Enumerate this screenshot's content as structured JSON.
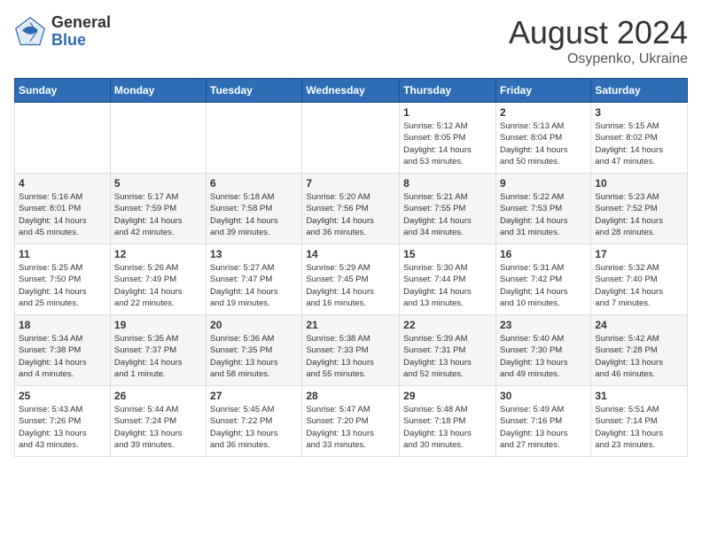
{
  "header": {
    "logo_general": "General",
    "logo_blue": "Blue",
    "month_year": "August 2024",
    "location": "Osypenko, Ukraine"
  },
  "days_of_week": [
    "Sunday",
    "Monday",
    "Tuesday",
    "Wednesday",
    "Thursday",
    "Friday",
    "Saturday"
  ],
  "weeks": [
    [
      {
        "day": "",
        "info": ""
      },
      {
        "day": "",
        "info": ""
      },
      {
        "day": "",
        "info": ""
      },
      {
        "day": "",
        "info": ""
      },
      {
        "day": "1",
        "info": "Sunrise: 5:12 AM\nSunset: 8:05 PM\nDaylight: 14 hours\nand 53 minutes."
      },
      {
        "day": "2",
        "info": "Sunrise: 5:13 AM\nSunset: 8:04 PM\nDaylight: 14 hours\nand 50 minutes."
      },
      {
        "day": "3",
        "info": "Sunrise: 5:15 AM\nSunset: 8:02 PM\nDaylight: 14 hours\nand 47 minutes."
      }
    ],
    [
      {
        "day": "4",
        "info": "Sunrise: 5:16 AM\nSunset: 8:01 PM\nDaylight: 14 hours\nand 45 minutes."
      },
      {
        "day": "5",
        "info": "Sunrise: 5:17 AM\nSunset: 7:59 PM\nDaylight: 14 hours\nand 42 minutes."
      },
      {
        "day": "6",
        "info": "Sunrise: 5:18 AM\nSunset: 7:58 PM\nDaylight: 14 hours\nand 39 minutes."
      },
      {
        "day": "7",
        "info": "Sunrise: 5:20 AM\nSunset: 7:56 PM\nDaylight: 14 hours\nand 36 minutes."
      },
      {
        "day": "8",
        "info": "Sunrise: 5:21 AM\nSunset: 7:55 PM\nDaylight: 14 hours\nand 34 minutes."
      },
      {
        "day": "9",
        "info": "Sunrise: 5:22 AM\nSunset: 7:53 PM\nDaylight: 14 hours\nand 31 minutes."
      },
      {
        "day": "10",
        "info": "Sunrise: 5:23 AM\nSunset: 7:52 PM\nDaylight: 14 hours\nand 28 minutes."
      }
    ],
    [
      {
        "day": "11",
        "info": "Sunrise: 5:25 AM\nSunset: 7:50 PM\nDaylight: 14 hours\nand 25 minutes."
      },
      {
        "day": "12",
        "info": "Sunrise: 5:26 AM\nSunset: 7:49 PM\nDaylight: 14 hours\nand 22 minutes."
      },
      {
        "day": "13",
        "info": "Sunrise: 5:27 AM\nSunset: 7:47 PM\nDaylight: 14 hours\nand 19 minutes."
      },
      {
        "day": "14",
        "info": "Sunrise: 5:29 AM\nSunset: 7:45 PM\nDaylight: 14 hours\nand 16 minutes."
      },
      {
        "day": "15",
        "info": "Sunrise: 5:30 AM\nSunset: 7:44 PM\nDaylight: 14 hours\nand 13 minutes."
      },
      {
        "day": "16",
        "info": "Sunrise: 5:31 AM\nSunset: 7:42 PM\nDaylight: 14 hours\nand 10 minutes."
      },
      {
        "day": "17",
        "info": "Sunrise: 5:32 AM\nSunset: 7:40 PM\nDaylight: 14 hours\nand 7 minutes."
      }
    ],
    [
      {
        "day": "18",
        "info": "Sunrise: 5:34 AM\nSunset: 7:38 PM\nDaylight: 14 hours\nand 4 minutes."
      },
      {
        "day": "19",
        "info": "Sunrise: 5:35 AM\nSunset: 7:37 PM\nDaylight: 14 hours\nand 1 minute."
      },
      {
        "day": "20",
        "info": "Sunrise: 5:36 AM\nSunset: 7:35 PM\nDaylight: 13 hours\nand 58 minutes."
      },
      {
        "day": "21",
        "info": "Sunrise: 5:38 AM\nSunset: 7:33 PM\nDaylight: 13 hours\nand 55 minutes."
      },
      {
        "day": "22",
        "info": "Sunrise: 5:39 AM\nSunset: 7:31 PM\nDaylight: 13 hours\nand 52 minutes."
      },
      {
        "day": "23",
        "info": "Sunrise: 5:40 AM\nSunset: 7:30 PM\nDaylight: 13 hours\nand 49 minutes."
      },
      {
        "day": "24",
        "info": "Sunrise: 5:42 AM\nSunset: 7:28 PM\nDaylight: 13 hours\nand 46 minutes."
      }
    ],
    [
      {
        "day": "25",
        "info": "Sunrise: 5:43 AM\nSunset: 7:26 PM\nDaylight: 13 hours\nand 43 minutes."
      },
      {
        "day": "26",
        "info": "Sunrise: 5:44 AM\nSunset: 7:24 PM\nDaylight: 13 hours\nand 39 minutes."
      },
      {
        "day": "27",
        "info": "Sunrise: 5:45 AM\nSunset: 7:22 PM\nDaylight: 13 hours\nand 36 minutes."
      },
      {
        "day": "28",
        "info": "Sunrise: 5:47 AM\nSunset: 7:20 PM\nDaylight: 13 hours\nand 33 minutes."
      },
      {
        "day": "29",
        "info": "Sunrise: 5:48 AM\nSunset: 7:18 PM\nDaylight: 13 hours\nand 30 minutes."
      },
      {
        "day": "30",
        "info": "Sunrise: 5:49 AM\nSunset: 7:16 PM\nDaylight: 13 hours\nand 27 minutes."
      },
      {
        "day": "31",
        "info": "Sunrise: 5:51 AM\nSunset: 7:14 PM\nDaylight: 13 hours\nand 23 minutes."
      }
    ]
  ]
}
